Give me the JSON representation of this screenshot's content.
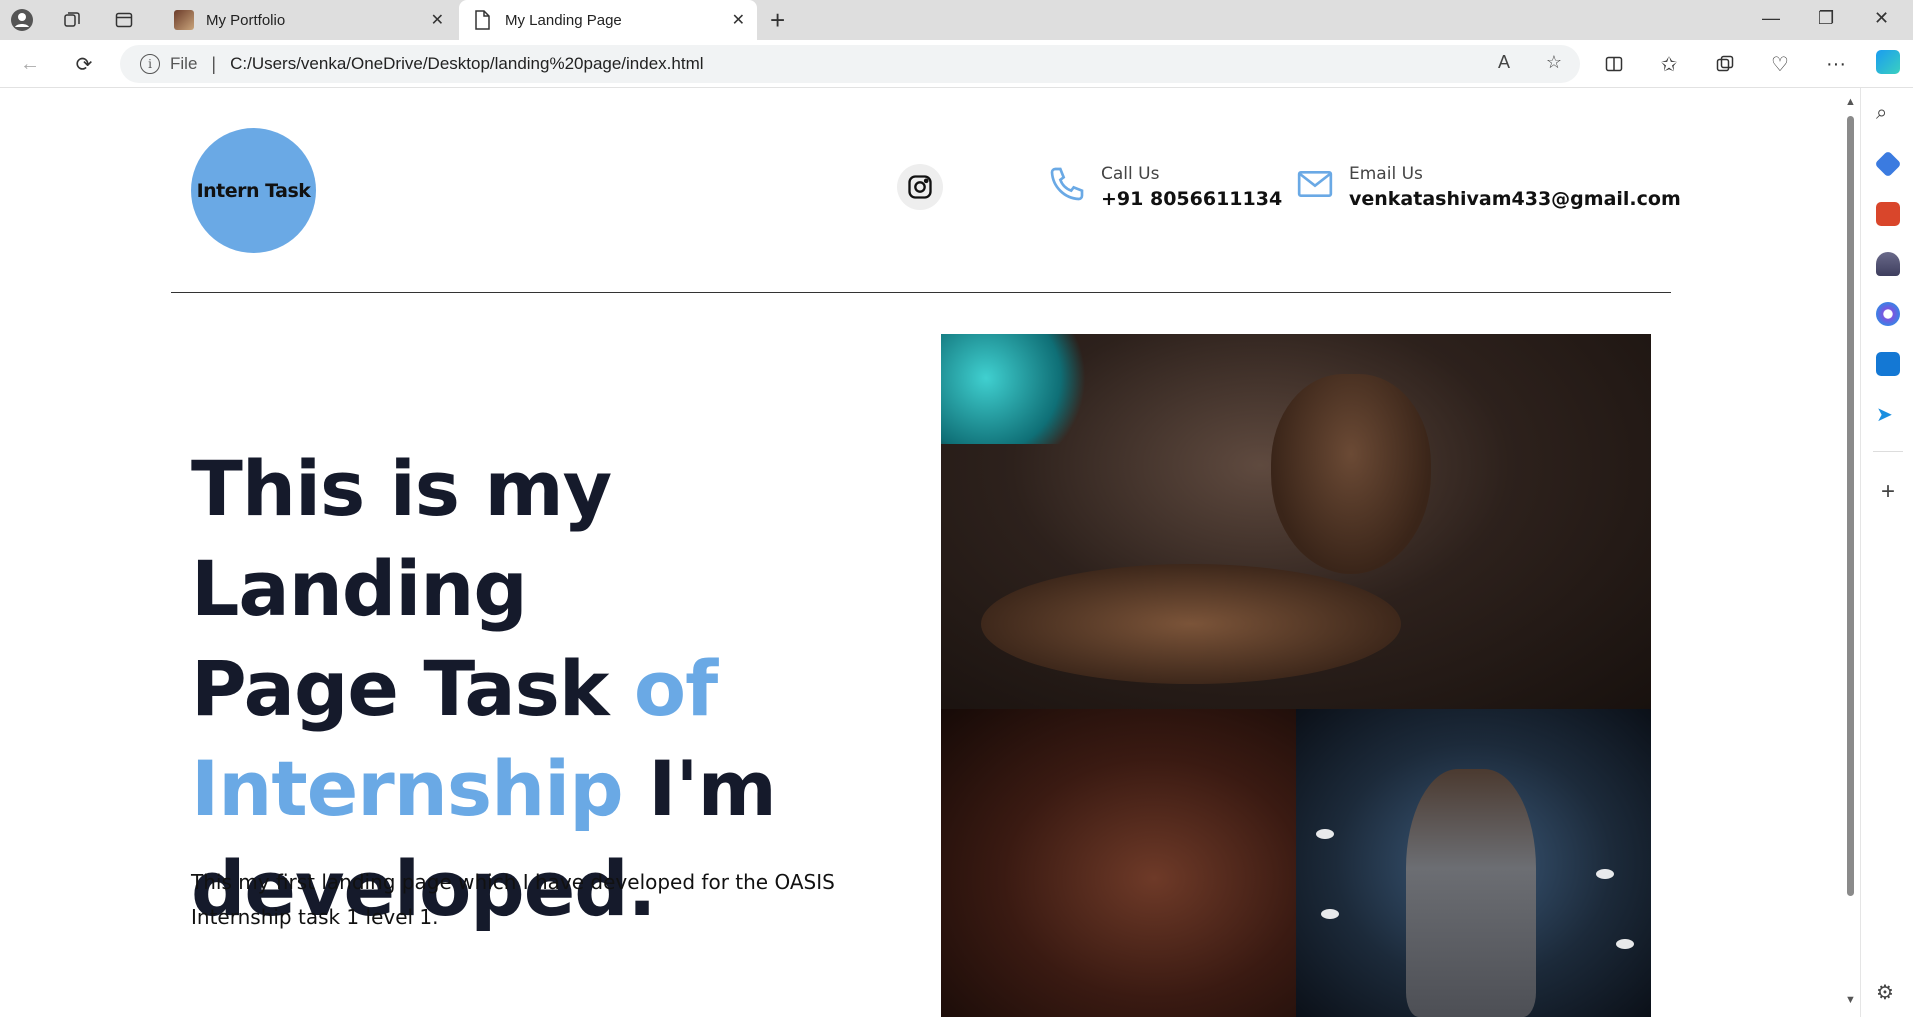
{
  "browser": {
    "tabs": [
      {
        "title": "My Portfolio"
      },
      {
        "title": "My Landing Page"
      }
    ],
    "address": {
      "scheme_label": "File",
      "url": "C:/Users/venka/OneDrive/Desktop/landing%20page/index.html"
    }
  },
  "header": {
    "logo_text": "Intern Task",
    "call": {
      "label": "Call Us",
      "value": "+91 8056611134"
    },
    "email": {
      "label": "Email Us",
      "value": "venkatashivam433@gmail.com"
    }
  },
  "hero": {
    "line1": "This is my Landing",
    "line2_dark": "Page Task ",
    "line2_blue": "of",
    "line3_blue": "Internship",
    "line3_dark": " I'm",
    "line4": "developed.",
    "description": "This my first landing page which I have developed for the OASIS Internship task 1 level 1."
  },
  "colors": {
    "accent": "#6aa9e5",
    "heading": "#151a2b"
  }
}
